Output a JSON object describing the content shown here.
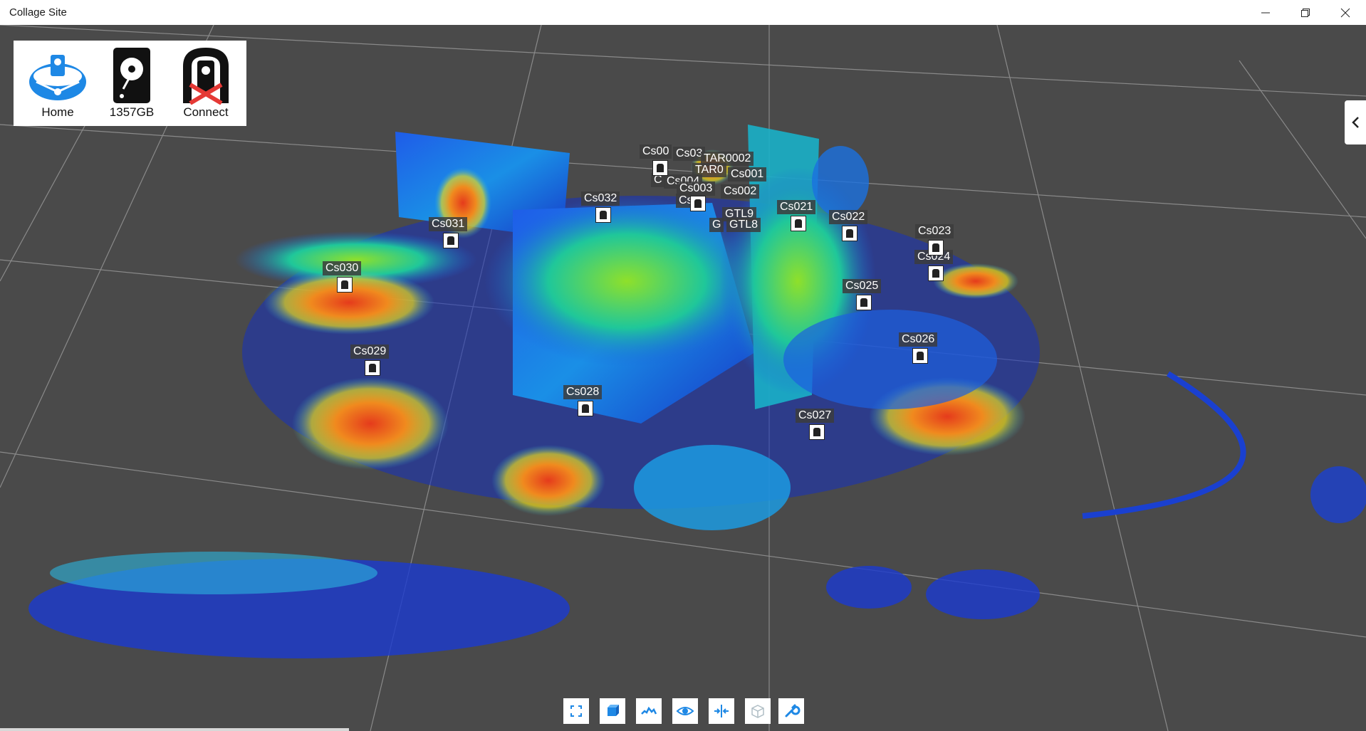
{
  "window": {
    "title": "Collage Site",
    "minimize_icon": "minimize-icon",
    "maximize_icon": "restore-icon",
    "close_icon": "close-icon"
  },
  "panel": {
    "home_label": "Home",
    "storage_label": "1357GB",
    "connect_label": "Connect"
  },
  "scan_labels": [
    "Cs00",
    "Cs03",
    "TAR0002",
    "TAR0",
    "Cs001",
    "C",
    "Cs004",
    "Cs003",
    "Cs002",
    "Cs0",
    "GTL9",
    "GTL8",
    "G",
    "Cs032",
    "Cs031",
    "Cs030",
    "Cs021",
    "Cs022",
    "Cs023",
    "Cs024",
    "Cs025",
    "Cs026",
    "Cs029",
    "Cs028",
    "Cs027"
  ],
  "toolbar": {
    "icons": [
      "fit-view-icon",
      "cube-view-icon",
      "point-cloud-icon",
      "eye-icon",
      "split-view-icon",
      "box-icon",
      "wrench-icon"
    ]
  },
  "colors": {
    "background": "#4a4a4a",
    "titlebar": "#ffffff",
    "accent_blue": "#1e88e5",
    "connect_error": "#e53935"
  }
}
